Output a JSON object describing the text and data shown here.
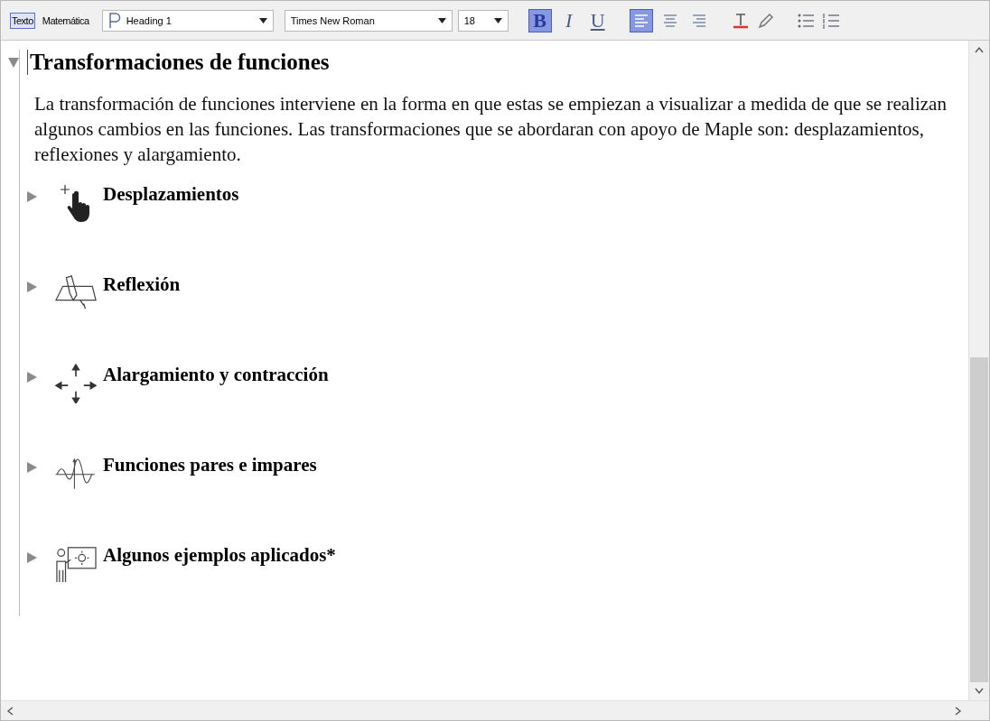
{
  "toolbar": {
    "modes": [
      {
        "label": "Texto",
        "selected": true
      },
      {
        "label": "Matemática",
        "selected": false
      }
    ],
    "style": "Heading 1",
    "font": "Times New Roman",
    "size": "18",
    "format": [
      {
        "kind": "bold",
        "label": "B",
        "selected": true
      },
      {
        "kind": "italic",
        "label": "I",
        "selected": false
      },
      {
        "kind": "underline",
        "label": "U",
        "selected": false
      }
    ],
    "align": [
      {
        "kind": "left",
        "selected": true
      },
      {
        "kind": "center",
        "selected": false
      },
      {
        "kind": "right",
        "selected": false
      }
    ]
  },
  "section": {
    "expanded": true,
    "title": "Transformaciones de funciones",
    "paragraph": "La transformación de funciones interviene en la forma en que estas se empiezan a visualizar a medida de que se realizan algunos cambios en las funciones. Las transformaciones que se abordaran con apoyo de Maple son: desplazamientos, reflexiones y alargamiento.",
    "subsections": [
      {
        "kind": "hand",
        "title": "Desplazamientos",
        "expanded": false
      },
      {
        "kind": "reflection",
        "title": "Reflexión",
        "expanded": false
      },
      {
        "kind": "arrows",
        "title": "Alargamiento y contracción",
        "expanded": false
      },
      {
        "kind": "wave",
        "title": "Funciones pares e impares",
        "expanded": false
      },
      {
        "kind": "presenter",
        "title": "Algunos ejemplos aplicados*",
        "expanded": false
      }
    ]
  }
}
